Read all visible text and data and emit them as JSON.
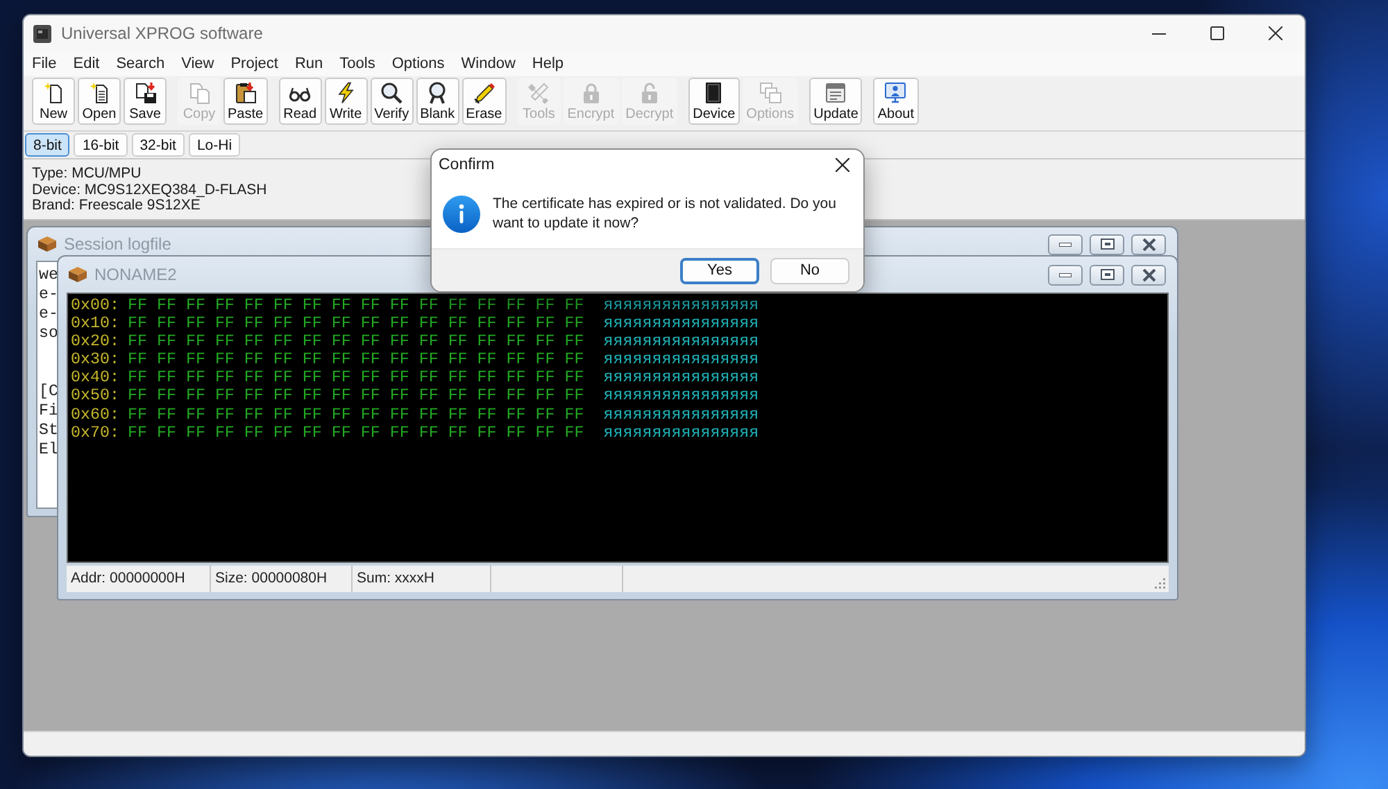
{
  "window": {
    "title": "Universal XPROG software"
  },
  "menu": [
    "File",
    "Edit",
    "Search",
    "View",
    "Project",
    "Run",
    "Tools",
    "Options",
    "Window",
    "Help"
  ],
  "toolbar": [
    [
      {
        "label": "New",
        "disabled": false
      },
      {
        "label": "Open",
        "disabled": false
      },
      {
        "label": "Save",
        "disabled": false
      }
    ],
    [
      {
        "label": "Copy",
        "disabled": true
      },
      {
        "label": "Paste",
        "disabled": false
      }
    ],
    [
      {
        "label": "Read",
        "disabled": false
      },
      {
        "label": "Write",
        "disabled": false
      },
      {
        "label": "Verify",
        "disabled": false
      },
      {
        "label": "Blank",
        "disabled": false
      },
      {
        "label": "Erase",
        "disabled": false
      }
    ],
    [
      {
        "label": "Tools",
        "disabled": true
      },
      {
        "label": "Encrypt",
        "disabled": true
      },
      {
        "label": "Decrypt",
        "disabled": true
      }
    ],
    [
      {
        "label": "Device",
        "disabled": false
      },
      {
        "label": "Options",
        "disabled": true
      }
    ],
    [
      {
        "label": "Update",
        "disabled": false
      }
    ],
    [
      {
        "label": "About",
        "disabled": false
      }
    ]
  ],
  "width_modes": [
    {
      "label": "8-bit",
      "selected": true
    },
    {
      "label": "16-bit",
      "selected": false
    },
    {
      "label": "32-bit",
      "selected": false
    },
    {
      "label": "Lo-Hi",
      "selected": false
    }
  ],
  "device_info": [
    "Type: MCU/MPU",
    "Device: MC9S12XEQ384_D-FLASH",
    "Brand: Freescale 9S12XE"
  ],
  "session_log": {
    "title": "Session logfile",
    "line_groups": [
      [
        "we",
        "e-",
        "e-",
        "so"
      ],
      [
        "[C",
        "Fi",
        "St",
        "El"
      ]
    ]
  },
  "hex_window": {
    "title": "NONAME2",
    "rows": [
      {
        "address": "0x00:",
        "bytes": "FF FF FF FF FF FF FF FF FF FF FF FF FF FF FF FF",
        "ascii": "яяяяяяяяяяяяяяяя"
      },
      {
        "address": "0x10:",
        "bytes": "FF FF FF FF FF FF FF FF FF FF FF FF FF FF FF FF",
        "ascii": "яяяяяяяяяяяяяяяя"
      },
      {
        "address": "0x20:",
        "bytes": "FF FF FF FF FF FF FF FF FF FF FF FF FF FF FF FF",
        "ascii": "яяяяяяяяяяяяяяяя"
      },
      {
        "address": "0x30:",
        "bytes": "FF FF FF FF FF FF FF FF FF FF FF FF FF FF FF FF",
        "ascii": "яяяяяяяяяяяяяяяя"
      },
      {
        "address": "0x40:",
        "bytes": "FF FF FF FF FF FF FF FF FF FF FF FF FF FF FF FF",
        "ascii": "яяяяяяяяяяяяяяяя"
      },
      {
        "address": "0x50:",
        "bytes": "FF FF FF FF FF FF FF FF FF FF FF FF FF FF FF FF",
        "ascii": "яяяяяяяяяяяяяяяя"
      },
      {
        "address": "0x60:",
        "bytes": "FF FF FF FF FF FF FF FF FF FF FF FF FF FF FF FF",
        "ascii": "яяяяяяяяяяяяяяяя"
      },
      {
        "address": "0x70:",
        "bytes": "FF FF FF FF FF FF FF FF FF FF FF FF FF FF FF FF",
        "ascii": "яяяяяяяяяяяяяяяя"
      }
    ],
    "status": [
      "Addr: 00000000H",
      "Size: 00000080H",
      "Sum: xxxxH"
    ]
  },
  "dialog": {
    "title": "Confirm",
    "message": "The certificate has expired or is not validated. Do you want to update it now?",
    "buttons": [
      {
        "label": "Yes",
        "default": true
      },
      {
        "label": "No",
        "default": false
      }
    ]
  }
}
